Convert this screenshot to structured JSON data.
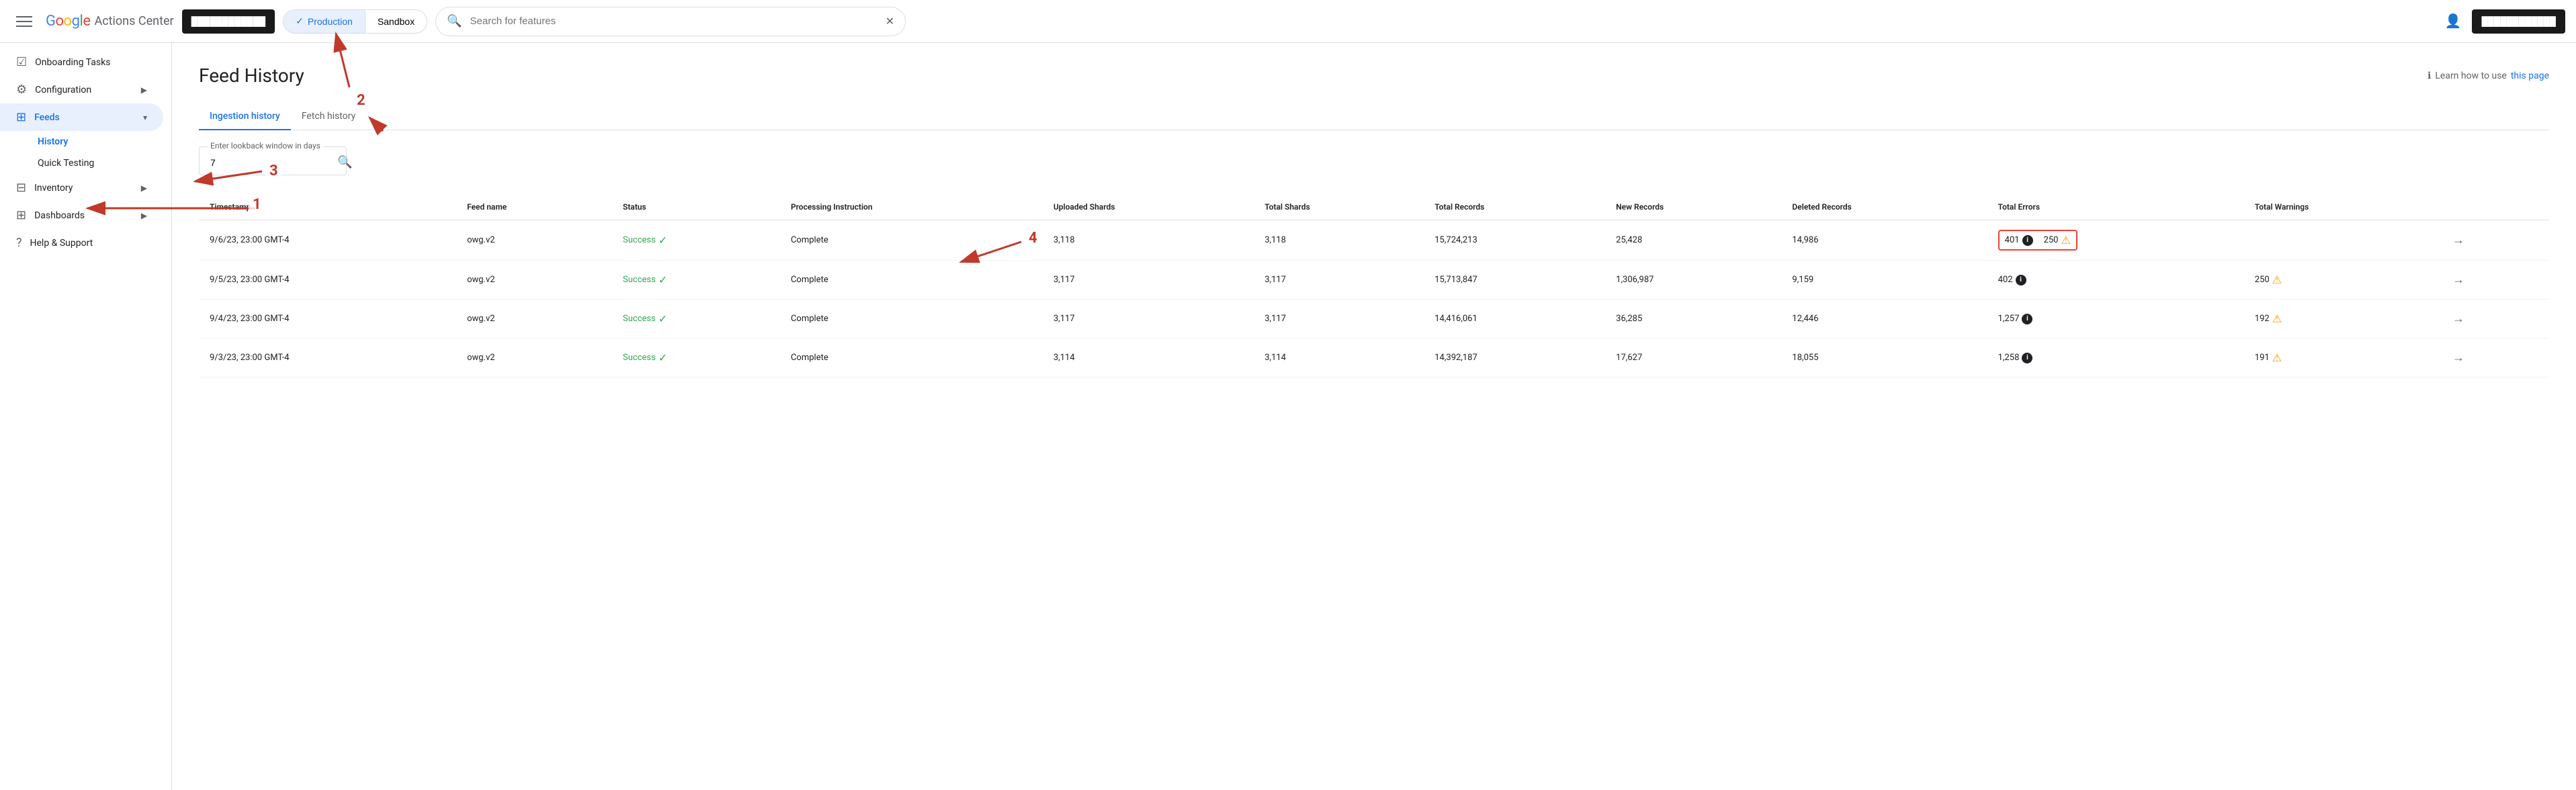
{
  "header": {
    "hamburger_label": "Menu",
    "logo": {
      "google": "Google",
      "title": "Actions Center"
    },
    "account_pill": "████████████",
    "env_switcher": {
      "production_label": "Production",
      "sandbox_label": "Sandbox",
      "active": "production"
    },
    "search_placeholder": "Search for features",
    "account_btn": "████████████"
  },
  "sidebar": {
    "items": [
      {
        "id": "onboarding",
        "label": "Onboarding Tasks",
        "icon": "☑",
        "active": false,
        "expandable": false
      },
      {
        "id": "configuration",
        "label": "Configuration",
        "icon": "⚙",
        "active": false,
        "expandable": true
      },
      {
        "id": "feeds",
        "label": "Feeds",
        "icon": "⊞",
        "active": true,
        "expandable": true
      },
      {
        "id": "inventory",
        "label": "Inventory",
        "icon": "⊟",
        "active": false,
        "expandable": true
      },
      {
        "id": "dashboards",
        "label": "Dashboards",
        "icon": "⊞",
        "active": false,
        "expandable": true
      },
      {
        "id": "help",
        "label": "Help & Support",
        "icon": "?",
        "active": false,
        "expandable": false
      }
    ],
    "feeds_subitems": [
      {
        "id": "history",
        "label": "History",
        "active": true
      },
      {
        "id": "quick_testing",
        "label": "Quick Testing",
        "active": false
      }
    ]
  },
  "page": {
    "title": "Feed History",
    "help_text": "Learn how to use",
    "help_link_text": "this page",
    "tabs": [
      {
        "id": "ingestion",
        "label": "Ingestion history",
        "active": true
      },
      {
        "id": "fetch",
        "label": "Fetch history",
        "active": false
      }
    ],
    "lookback_label": "Enter lookback window in days",
    "lookback_value": "7"
  },
  "table": {
    "columns": [
      "Timestamp",
      "Feed name",
      "Status",
      "Processing Instruction",
      "Uploaded Shards",
      "Total Shards",
      "Total Records",
      "New Records",
      "Deleted Records",
      "Total Errors",
      "Total Warnings"
    ],
    "rows": [
      {
        "timestamp": "9/6/23, 23:00 GMT-4",
        "feed_name": "owg.v2",
        "status": "Success",
        "processing_instruction": "Complete",
        "uploaded_shards": "3,118",
        "total_shards": "3,118",
        "total_records": "15,724,213",
        "new_records": "25,428",
        "deleted_records": "14,986",
        "total_errors": "401",
        "total_warnings": "250",
        "highlighted": true
      },
      {
        "timestamp": "9/5/23, 23:00 GMT-4",
        "feed_name": "owg.v2",
        "status": "Success",
        "processing_instruction": "Complete",
        "uploaded_shards": "3,117",
        "total_shards": "3,117",
        "total_records": "15,713,847",
        "new_records": "1,306,987",
        "deleted_records": "9,159",
        "total_errors": "402",
        "total_warnings": "250",
        "highlighted": false
      },
      {
        "timestamp": "9/4/23, 23:00 GMT-4",
        "feed_name": "owg.v2",
        "status": "Success",
        "processing_instruction": "Complete",
        "uploaded_shards": "3,117",
        "total_shards": "3,117",
        "total_records": "14,416,061",
        "new_records": "36,285",
        "deleted_records": "12,446",
        "total_errors": "1,257",
        "total_warnings": "192",
        "highlighted": false
      },
      {
        "timestamp": "9/3/23, 23:00 GMT-4",
        "feed_name": "owg.v2",
        "status": "Success",
        "processing_instruction": "Complete",
        "uploaded_shards": "3,114",
        "total_shards": "3,114",
        "total_records": "14,392,187",
        "new_records": "17,627",
        "deleted_records": "18,055",
        "total_errors": "1,258",
        "total_warnings": "191",
        "highlighted": false
      }
    ]
  },
  "annotations": {
    "labels": [
      "1",
      "2",
      "3",
      "4"
    ]
  }
}
